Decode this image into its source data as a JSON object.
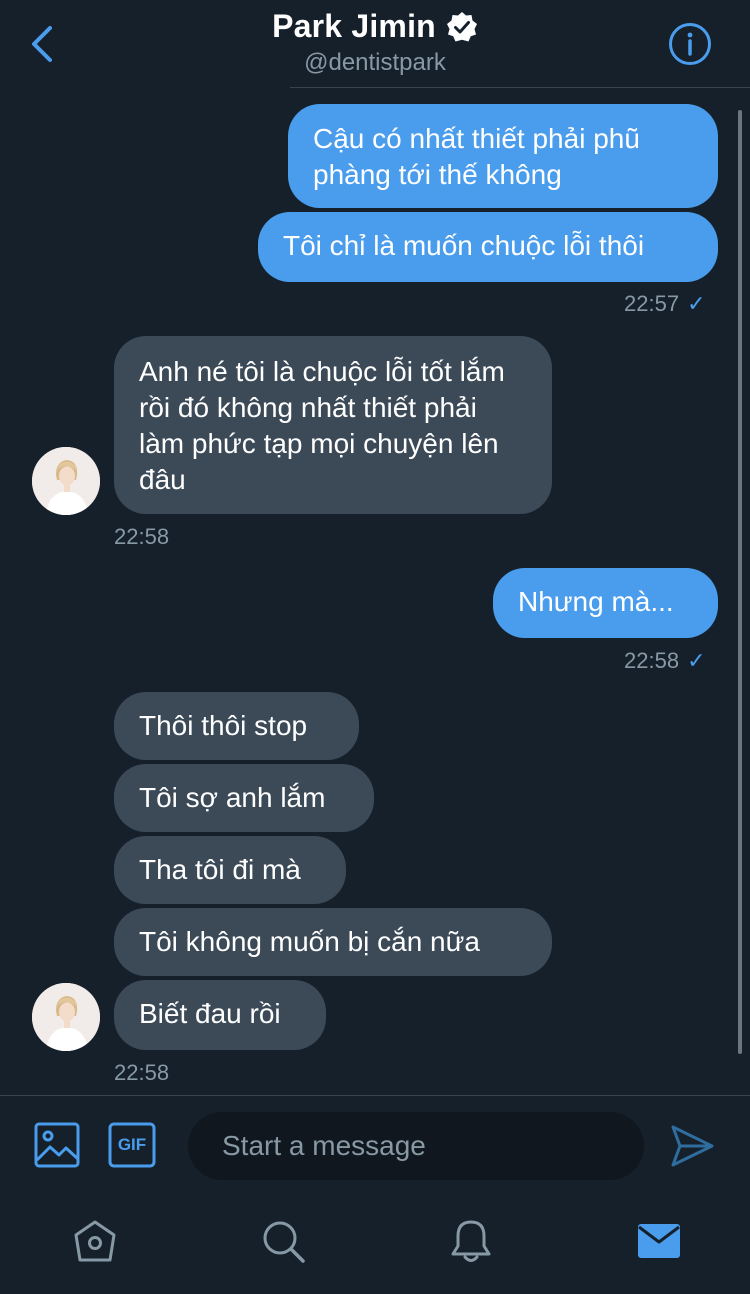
{
  "header": {
    "title": "Park Jimin",
    "handle": "@dentistpark",
    "icons": [
      "back-chevron-icon",
      "verified-badge-icon",
      "info-icon"
    ]
  },
  "colors": {
    "background": "#15202b",
    "accent": "#4a9ded",
    "incoming_bubble": "#3c4a58",
    "muted_text": "#8899a6"
  },
  "messages": {
    "m1": "Cậu có nhất thiết phải phũ phàng tới thế không",
    "m2": "Tôi chỉ là muốn chuộc lỗi thôi",
    "t1": "22:57",
    "m3": "Anh né tôi là chuộc lỗi tốt lắm rồi đó không nhất thiết phải làm phức tạp mọi chuyện lên đâu",
    "t2": "22:58",
    "m4": "Nhưng mà...",
    "t3": "22:58",
    "m5": "Thôi thôi stop",
    "m6": "Tôi sợ anh lắm",
    "m7": "Tha tôi đi mà",
    "m8": "Tôi không muốn bị cắn nữa",
    "m9": "Biết đau rồi",
    "t4": "22:58",
    "check": "✓"
  },
  "composer": {
    "placeholder": "Start a message",
    "icons": [
      "image-icon",
      "gif-icon",
      "send-icon"
    ],
    "gif_label": "GIF"
  },
  "tabbar": {
    "icons": [
      "home-icon",
      "search-icon",
      "notifications-bell-icon",
      "messages-mail-icon"
    ],
    "active": "messages-mail-icon"
  }
}
